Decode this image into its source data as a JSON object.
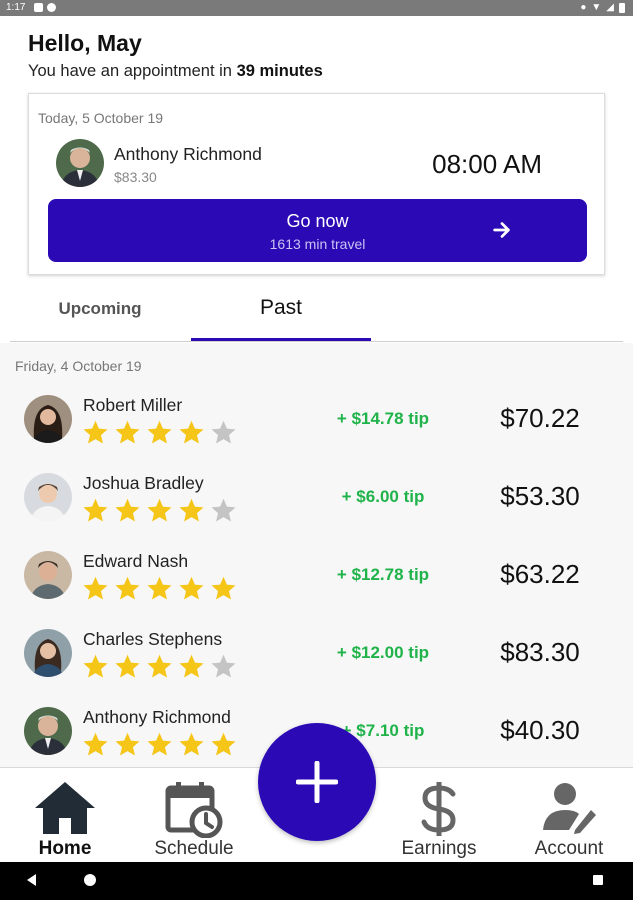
{
  "status_bar": {
    "time": "1:17"
  },
  "greeting": "Hello, May",
  "appointment_notice": {
    "prefix": "You have an appointment in ",
    "value": "39 minutes"
  },
  "next_appointment": {
    "date": "Today, 5 October 19",
    "client_name": "Anthony Richmond",
    "price": "$83.30",
    "time": "08:00 AM",
    "go_button": {
      "label": "Go now",
      "travel": "1613 min travel"
    }
  },
  "tabs": [
    {
      "label": "Upcoming",
      "active": false
    },
    {
      "label": "Past",
      "active": true
    }
  ],
  "past": {
    "section_date": "Friday, 4 October 19",
    "rows": [
      {
        "name": "Robert Miller",
        "rating": 4,
        "tip": "+ $14.78 tip",
        "amount": "$70.22"
      },
      {
        "name": "Joshua Bradley",
        "rating": 4,
        "tip": "+ $6.00 tip",
        "amount": "$53.30"
      },
      {
        "name": "Edward Nash",
        "rating": 5,
        "tip": "+ $12.78 tip",
        "amount": "$63.22"
      },
      {
        "name": "Charles Stephens",
        "rating": 4,
        "tip": "+ $12.00 tip",
        "amount": "$83.30"
      },
      {
        "name": "Anthony Richmond",
        "rating": 5,
        "tip": "+ $7.10 tip",
        "amount": "$40.30"
      }
    ]
  },
  "bottom_nav": [
    {
      "label": "Home",
      "icon": "home-icon",
      "active": true
    },
    {
      "label": "Schedule",
      "icon": "schedule-icon",
      "active": false
    },
    {
      "label": "Earnings",
      "icon": "dollar-icon",
      "active": false
    },
    {
      "label": "Account",
      "icon": "account-icon",
      "active": false
    }
  ],
  "fab": {
    "icon": "plus-icon"
  },
  "colors": {
    "accent": "#2b0ab6",
    "tip": "#1fb34a",
    "star_filled": "#f5c518",
    "star_empty": "#c4c4c4"
  }
}
